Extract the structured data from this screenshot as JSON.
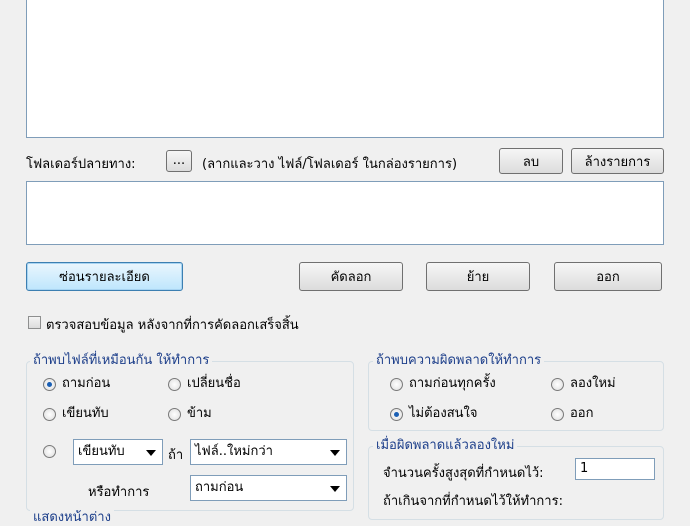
{
  "destination": {
    "label": "โฟลเดอร์ปลายทาง:",
    "browse_label": "...",
    "hint": "(ลากและวาง ไฟล์/โฟลเดอร์ ในกล่องรายการ)",
    "delete_label": "ลบ",
    "clear_label": "ล้างรายการ"
  },
  "actions": {
    "hide_details_label": "ซ่อนรายละเอียด",
    "copy_label": "คัดลอก",
    "move_label": "ย้าย",
    "exit_label": "ออก"
  },
  "verify": {
    "label": "ตรวจสอบข้อมูล หลังจากที่การคัดลอกเสร็จสิ้น",
    "checked": false
  },
  "same_file_group": {
    "title": "ถ้าพบไฟล์ที่เหมือนกัน ให้ทำการ",
    "options": {
      "ask_first": "ถามก่อน",
      "rename": "เปลี่ยนชื่อ",
      "overwrite": "เขียนทับ",
      "skip": "ข้าม"
    },
    "selected": "ask_first",
    "condition_action": "เขียนทับ",
    "if_label": "ถ้า",
    "condition_value": "ไฟล์..ใหม่กว่า",
    "otherwise_label": "หรือทำการ",
    "otherwise_value": "ถามก่อน"
  },
  "error_group": {
    "title": "ถ้าพบความผิดพลาดให้ทำการ",
    "options": {
      "ask_every_time": "ถามก่อนทุกครั้ง",
      "retry": "ลองใหม่",
      "ignore": "ไม่ต้องสนใจ",
      "exit": "ออก"
    },
    "selected": "ignore"
  },
  "retry_group": {
    "title": "เมื่อผิดพลาดแล้วลองใหม่",
    "max_count_label": "จำนวนครั้งสูงสุดที่กำหนดไว้:",
    "max_count_value": "1",
    "exceed_label": "ถ้าเกินจากที่กำหนดไว้ให้ทำการ:"
  },
  "partial_group": {
    "title": "แสดงหน้าต่าง"
  }
}
